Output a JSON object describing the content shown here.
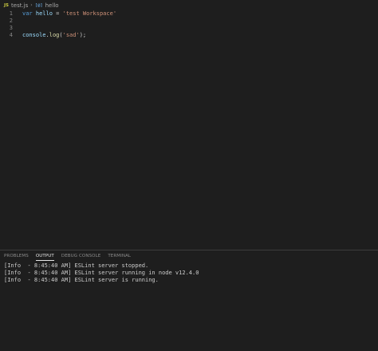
{
  "breadcrumb": {
    "file_icon": "JS",
    "file_name": "test.js",
    "separator": "›",
    "symbol_icon": "[@]",
    "symbol_name": "hello"
  },
  "editor": {
    "lines": [
      {
        "number": "1",
        "code": "var hello = 'test Workspace'"
      },
      {
        "number": "2",
        "code": ""
      },
      {
        "number": "3",
        "code": ""
      },
      {
        "number": "4",
        "code": "console.log('sad');"
      }
    ],
    "tokens": {
      "line1": {
        "kw": "var",
        "var": "hello",
        "op": "=",
        "str": "'test Workspace'"
      },
      "line4": {
        "obj": "console",
        "dot": ".",
        "fn": "log",
        "open": "(",
        "str": "'sad'",
        "close": ");"
      }
    }
  },
  "panel": {
    "tabs": [
      {
        "label": "PROBLEMS",
        "active": false
      },
      {
        "label": "OUTPUT",
        "active": true
      },
      {
        "label": "DEBUG CONSOLE",
        "active": false
      },
      {
        "label": "TERMINAL",
        "active": false
      }
    ],
    "output_lines": [
      "[Info  - 8:45:40 AM] ESLint server stopped.",
      "[Info  - 8:45:40 AM] ESLint server running in node v12.4.0",
      "[Info  - 8:45:40 AM] ESLint server is running."
    ]
  },
  "colors": {
    "background": "#1e1e1e",
    "keyword": "#569cd6",
    "variable": "#9cdcfe",
    "string": "#ce9178",
    "function": "#dcdcaa",
    "js_icon": "#cbcb41"
  }
}
